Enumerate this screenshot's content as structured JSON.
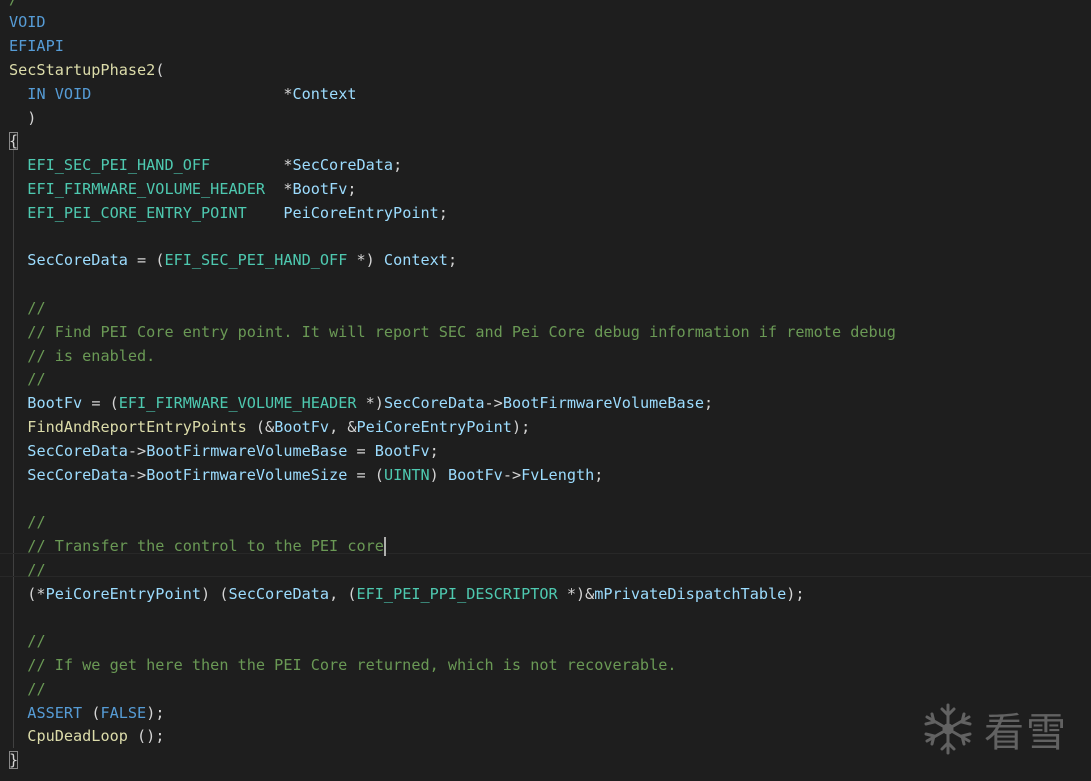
{
  "editor": {
    "language": "c",
    "cursor_line_index": 23,
    "lines": [
      [
        {
          "t": "/",
          "c": "co"
        }
      ],
      [
        {
          "t": "VOID",
          "c": "kw"
        }
      ],
      [
        {
          "t": "EFIAPI",
          "c": "kw"
        }
      ],
      [
        {
          "t": "SecStartupPhase2",
          "c": "fn"
        },
        {
          "t": "(",
          "c": "pu"
        }
      ],
      [
        {
          "t": "  ",
          "c": "pu"
        },
        {
          "t": "IN",
          "c": "kw"
        },
        {
          "t": " ",
          "c": "pu"
        },
        {
          "t": "VOID",
          "c": "kw"
        },
        {
          "t": "                     *",
          "c": "pu"
        },
        {
          "t": "Context",
          "c": "va"
        }
      ],
      [
        {
          "t": "  )",
          "c": "pu"
        }
      ],
      [
        {
          "t": "{",
          "c": "pu",
          "match": true
        }
      ],
      [
        {
          "t": "  ",
          "c": "pu"
        },
        {
          "t": "EFI_SEC_PEI_HAND_OFF",
          "c": "ty"
        },
        {
          "t": "        *",
          "c": "pu"
        },
        {
          "t": "SecCoreData",
          "c": "va"
        },
        {
          "t": ";",
          "c": "pu"
        }
      ],
      [
        {
          "t": "  ",
          "c": "pu"
        },
        {
          "t": "EFI_FIRMWARE_VOLUME_HEADER",
          "c": "ty"
        },
        {
          "t": "  *",
          "c": "pu"
        },
        {
          "t": "BootFv",
          "c": "va"
        },
        {
          "t": ";",
          "c": "pu"
        }
      ],
      [
        {
          "t": "  ",
          "c": "pu"
        },
        {
          "t": "EFI_PEI_CORE_ENTRY_POINT",
          "c": "ty"
        },
        {
          "t": "    ",
          "c": "pu"
        },
        {
          "t": "PeiCoreEntryPoint",
          "c": "va"
        },
        {
          "t": ";",
          "c": "pu"
        }
      ],
      [],
      [
        {
          "t": "  ",
          "c": "pu"
        },
        {
          "t": "SecCoreData",
          "c": "va"
        },
        {
          "t": " = (",
          "c": "pu"
        },
        {
          "t": "EFI_SEC_PEI_HAND_OFF",
          "c": "ty"
        },
        {
          "t": " *) ",
          "c": "pu"
        },
        {
          "t": "Context",
          "c": "va"
        },
        {
          "t": ";",
          "c": "pu"
        }
      ],
      [],
      [
        {
          "t": "  ",
          "c": "pu"
        },
        {
          "t": "//",
          "c": "co"
        }
      ],
      [
        {
          "t": "  ",
          "c": "pu"
        },
        {
          "t": "// Find PEI Core entry point. It will report SEC and Pei Core debug information if remote debug",
          "c": "co"
        }
      ],
      [
        {
          "t": "  ",
          "c": "pu"
        },
        {
          "t": "// is enabled.",
          "c": "co"
        }
      ],
      [
        {
          "t": "  ",
          "c": "pu"
        },
        {
          "t": "//",
          "c": "co"
        }
      ],
      [
        {
          "t": "  ",
          "c": "pu"
        },
        {
          "t": "BootFv",
          "c": "va"
        },
        {
          "t": " = (",
          "c": "pu"
        },
        {
          "t": "EFI_FIRMWARE_VOLUME_HEADER",
          "c": "ty"
        },
        {
          "t": " *)",
          "c": "pu"
        },
        {
          "t": "SecCoreData",
          "c": "va"
        },
        {
          "t": "->",
          "c": "pu"
        },
        {
          "t": "BootFirmwareVolumeBase",
          "c": "va"
        },
        {
          "t": ";",
          "c": "pu"
        }
      ],
      [
        {
          "t": "  ",
          "c": "pu"
        },
        {
          "t": "FindAndReportEntryPoints",
          "c": "fn"
        },
        {
          "t": " (&",
          "c": "pu"
        },
        {
          "t": "BootFv",
          "c": "va"
        },
        {
          "t": ", &",
          "c": "pu"
        },
        {
          "t": "PeiCoreEntryPoint",
          "c": "va"
        },
        {
          "t": ");",
          "c": "pu"
        }
      ],
      [
        {
          "t": "  ",
          "c": "pu"
        },
        {
          "t": "SecCoreData",
          "c": "va"
        },
        {
          "t": "->",
          "c": "pu"
        },
        {
          "t": "BootFirmwareVolumeBase",
          "c": "va"
        },
        {
          "t": " = ",
          "c": "pu"
        },
        {
          "t": "BootFv",
          "c": "va"
        },
        {
          "t": ";",
          "c": "pu"
        }
      ],
      [
        {
          "t": "  ",
          "c": "pu"
        },
        {
          "t": "SecCoreData",
          "c": "va"
        },
        {
          "t": "->",
          "c": "pu"
        },
        {
          "t": "BootFirmwareVolumeSize",
          "c": "va"
        },
        {
          "t": " = (",
          "c": "pu"
        },
        {
          "t": "UINTN",
          "c": "ty"
        },
        {
          "t": ") ",
          "c": "pu"
        },
        {
          "t": "BootFv",
          "c": "va"
        },
        {
          "t": "->",
          "c": "pu"
        },
        {
          "t": "FvLength",
          "c": "va"
        },
        {
          "t": ";",
          "c": "pu"
        }
      ],
      [],
      [
        {
          "t": "  ",
          "c": "pu"
        },
        {
          "t": "//",
          "c": "co"
        }
      ],
      [
        {
          "t": "  ",
          "c": "pu"
        },
        {
          "t": "// Transfer the control to the PEI core",
          "c": "co"
        }
      ],
      [
        {
          "t": "  ",
          "c": "pu"
        },
        {
          "t": "//",
          "c": "co"
        }
      ],
      [
        {
          "t": "  (*",
          "c": "pu"
        },
        {
          "t": "PeiCoreEntryPoint",
          "c": "va"
        },
        {
          "t": ") (",
          "c": "pu"
        },
        {
          "t": "SecCoreData",
          "c": "va"
        },
        {
          "t": ", (",
          "c": "pu"
        },
        {
          "t": "EFI_PEI_PPI_DESCRIPTOR",
          "c": "ty"
        },
        {
          "t": " *)&",
          "c": "pu"
        },
        {
          "t": "mPrivateDispatchTable",
          "c": "va"
        },
        {
          "t": ");",
          "c": "pu"
        }
      ],
      [],
      [
        {
          "t": "  ",
          "c": "pu"
        },
        {
          "t": "//",
          "c": "co"
        }
      ],
      [
        {
          "t": "  ",
          "c": "pu"
        },
        {
          "t": "// If we get here then the PEI Core returned, which is not recoverable.",
          "c": "co"
        }
      ],
      [
        {
          "t": "  ",
          "c": "pu"
        },
        {
          "t": "//",
          "c": "co"
        }
      ],
      [
        {
          "t": "  ",
          "c": "pu"
        },
        {
          "t": "ASSERT",
          "c": "kw"
        },
        {
          "t": " (",
          "c": "pu"
        },
        {
          "t": "FALSE",
          "c": "kw"
        },
        {
          "t": ");",
          "c": "pu"
        }
      ],
      [
        {
          "t": "  ",
          "c": "pu"
        },
        {
          "t": "CpuDeadLoop",
          "c": "fn"
        },
        {
          "t": " ();",
          "c": "pu"
        }
      ],
      [
        {
          "t": "}",
          "c": "pu",
          "match": true
        }
      ]
    ]
  },
  "watermark": {
    "text": "看雪",
    "icon": "snowflake-icon"
  }
}
